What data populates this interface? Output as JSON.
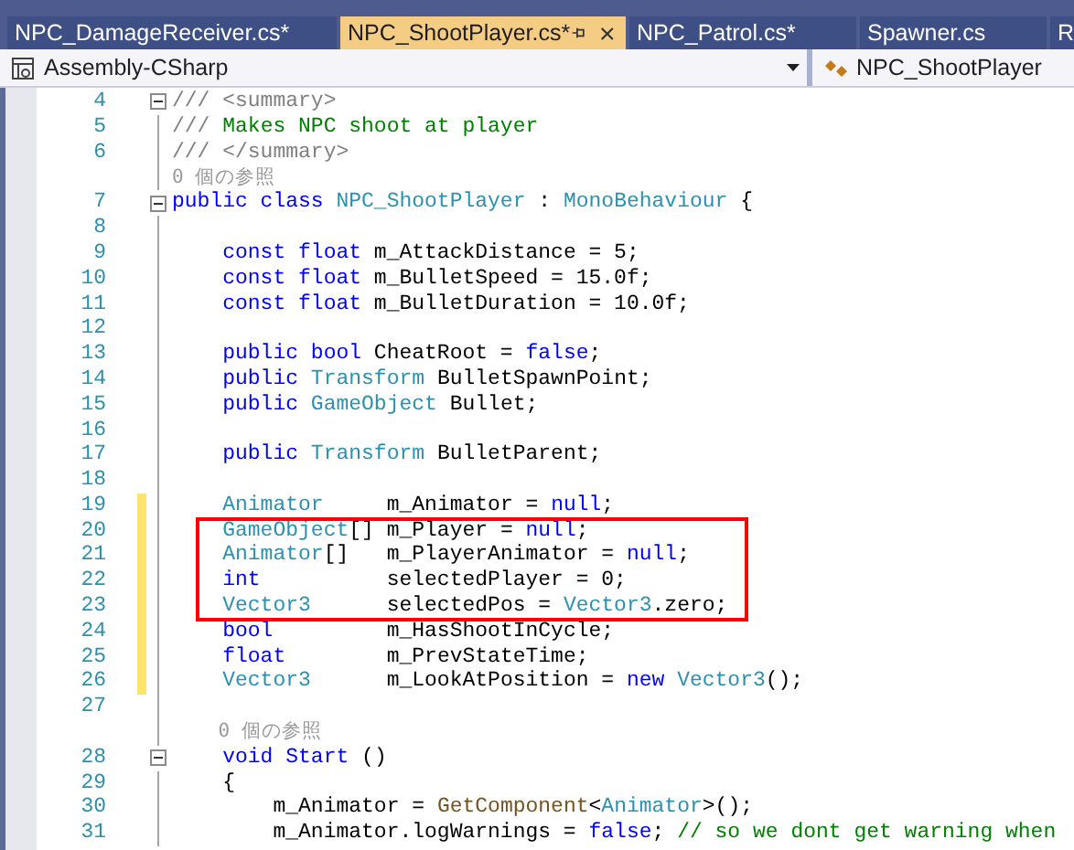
{
  "tabs": [
    {
      "label": "NPC_DamageReceiver.cs*",
      "selected": false
    },
    {
      "label": "NPC_ShootPlayer.cs*",
      "selected": true
    },
    {
      "label": "NPC_Patrol.cs*",
      "selected": false
    },
    {
      "label": "Spawner.cs",
      "selected": false
    },
    {
      "label": "R",
      "selected": false
    }
  ],
  "navigation_bar": {
    "project": "Assembly-CSharp",
    "class": "NPC_ShootPlayer"
  },
  "editor": {
    "lines": [
      {
        "kind": "code",
        "number": "4",
        "fold": true,
        "changed": false,
        "highlighted": false,
        "segments": [
          {
            "kind": "doc",
            "text": "/// <summary>"
          }
        ]
      },
      {
        "kind": "code",
        "number": "5",
        "fold": false,
        "changed": false,
        "highlighted": false,
        "segments": [
          {
            "kind": "doc",
            "text": "/// "
          },
          {
            "kind": "comment",
            "text": "Makes NPC shoot at player"
          }
        ]
      },
      {
        "kind": "code",
        "number": "6",
        "fold": false,
        "changed": false,
        "highlighted": false,
        "segments": [
          {
            "kind": "doc",
            "text": "/// </summary>"
          }
        ]
      },
      {
        "kind": "codelens",
        "text": "0 個の参照"
      },
      {
        "kind": "code",
        "number": "7",
        "fold": true,
        "changed": false,
        "highlighted": false,
        "segments": [
          {
            "kind": "keyword",
            "text": "public class "
          },
          {
            "kind": "type",
            "text": "NPC_ShootPlayer"
          },
          {
            "kind": "plain",
            "text": " : "
          },
          {
            "kind": "type",
            "text": "MonoBehaviour"
          },
          {
            "kind": "plain",
            "text": " {"
          }
        ]
      },
      {
        "kind": "code",
        "number": "8",
        "fold": false,
        "changed": false,
        "highlighted": false
      },
      {
        "kind": "code",
        "number": "9",
        "fold": false,
        "changed": false,
        "highlighted": false,
        "segments": [
          {
            "kind": "keyword",
            "text": "    const float "
          },
          {
            "kind": "plain",
            "text": "m_AttackDistance = 5;"
          }
        ]
      },
      {
        "kind": "code",
        "number": "10",
        "fold": false,
        "changed": false,
        "highlighted": false,
        "segments": [
          {
            "kind": "keyword",
            "text": "    const float "
          },
          {
            "kind": "plain",
            "text": "m_BulletSpeed = 15.0f;"
          }
        ]
      },
      {
        "kind": "code",
        "number": "11",
        "fold": false,
        "changed": false,
        "highlighted": false,
        "segments": [
          {
            "kind": "keyword",
            "text": "    const float "
          },
          {
            "kind": "plain",
            "text": "m_BulletDuration = 10.0f;"
          }
        ]
      },
      {
        "kind": "code",
        "number": "12",
        "fold": false,
        "changed": false,
        "highlighted": false
      },
      {
        "kind": "code",
        "number": "13",
        "fold": false,
        "changed": false,
        "highlighted": false,
        "segments": [
          {
            "kind": "keyword",
            "text": "    public bool "
          },
          {
            "kind": "plain",
            "text": "CheatRoot = "
          },
          {
            "kind": "keyword",
            "text": "false"
          },
          {
            "kind": "plain",
            "text": ";"
          }
        ]
      },
      {
        "kind": "code",
        "number": "14",
        "fold": false,
        "changed": false,
        "highlighted": false,
        "segments": [
          {
            "kind": "keyword",
            "text": "    public "
          },
          {
            "kind": "type",
            "text": "Transform"
          },
          {
            "kind": "plain",
            "text": " BulletSpawnPoint;"
          }
        ]
      },
      {
        "kind": "code",
        "number": "15",
        "fold": false,
        "changed": false,
        "highlighted": false,
        "segments": [
          {
            "kind": "keyword",
            "text": "    public "
          },
          {
            "kind": "type",
            "text": "GameObject"
          },
          {
            "kind": "plain",
            "text": " Bullet;"
          }
        ]
      },
      {
        "kind": "code",
        "number": "16",
        "fold": false,
        "changed": false,
        "highlighted": false
      },
      {
        "kind": "code",
        "number": "17",
        "fold": false,
        "changed": false,
        "highlighted": false,
        "segments": [
          {
            "kind": "keyword",
            "text": "    public "
          },
          {
            "kind": "type",
            "text": "Transform"
          },
          {
            "kind": "plain",
            "text": " BulletParent;"
          }
        ]
      },
      {
        "kind": "code",
        "number": "18",
        "fold": false,
        "changed": false,
        "highlighted": false
      },
      {
        "kind": "code",
        "number": "19",
        "fold": false,
        "changed": true,
        "highlighted": false,
        "segments": [
          {
            "kind": "type",
            "text": "    Animator"
          },
          {
            "kind": "plain",
            "text": "     m_Animator = "
          },
          {
            "kind": "keyword",
            "text": "null"
          },
          {
            "kind": "plain",
            "text": ";"
          }
        ]
      },
      {
        "kind": "code",
        "number": "20",
        "fold": false,
        "changed": true,
        "highlighted": true,
        "segments": [
          {
            "kind": "type",
            "text": "    GameObject"
          },
          {
            "kind": "plain",
            "text": "[] m_Player = "
          },
          {
            "kind": "keyword",
            "text": "null"
          },
          {
            "kind": "plain",
            "text": ";"
          }
        ]
      },
      {
        "kind": "code",
        "number": "21",
        "fold": false,
        "changed": true,
        "highlighted": true,
        "segments": [
          {
            "kind": "type",
            "text": "    Animator"
          },
          {
            "kind": "plain",
            "text": "[]   m_PlayerAnimator = "
          },
          {
            "kind": "keyword",
            "text": "null"
          },
          {
            "kind": "plain",
            "text": ";"
          }
        ]
      },
      {
        "kind": "code",
        "number": "22",
        "fold": false,
        "changed": true,
        "highlighted": true,
        "segments": [
          {
            "kind": "keyword",
            "text": "    int"
          },
          {
            "kind": "plain",
            "text": "          selectedPlayer = 0;"
          }
        ]
      },
      {
        "kind": "code",
        "number": "23",
        "fold": false,
        "changed": true,
        "highlighted": true,
        "segments": [
          {
            "kind": "type",
            "text": "    Vector3"
          },
          {
            "kind": "plain",
            "text": "      selectedPos = "
          },
          {
            "kind": "type",
            "text": "Vector3"
          },
          {
            "kind": "plain",
            "text": ".zero;"
          }
        ]
      },
      {
        "kind": "code",
        "number": "24",
        "fold": false,
        "changed": true,
        "highlighted": false,
        "segments": [
          {
            "kind": "keyword",
            "text": "    bool"
          },
          {
            "kind": "plain",
            "text": "         m_HasShootInCycle;"
          }
        ]
      },
      {
        "kind": "code",
        "number": "25",
        "fold": false,
        "changed": true,
        "highlighted": false,
        "segments": [
          {
            "kind": "keyword",
            "text": "    float"
          },
          {
            "kind": "plain",
            "text": "        m_PrevStateTime;"
          }
        ]
      },
      {
        "kind": "code",
        "number": "26",
        "fold": false,
        "changed": true,
        "highlighted": false,
        "segments": [
          {
            "kind": "type",
            "text": "    Vector3"
          },
          {
            "kind": "plain",
            "text": "      m_LookAtPosition = "
          },
          {
            "kind": "keyword",
            "text": "new "
          },
          {
            "kind": "type",
            "text": "Vector3"
          },
          {
            "kind": "plain",
            "text": "();"
          }
        ]
      },
      {
        "kind": "code",
        "number": "27",
        "fold": false,
        "changed": false,
        "highlighted": false
      },
      {
        "kind": "codelens",
        "text": "    0 個の参照"
      },
      {
        "kind": "code",
        "number": "28",
        "fold": true,
        "changed": false,
        "highlighted": false,
        "segments": [
          {
            "kind": "keyword",
            "text": "    void "
          },
          {
            "kind": "name",
            "text": "Start"
          },
          {
            "kind": "plain",
            "text": " ()"
          }
        ]
      },
      {
        "kind": "code",
        "number": "29",
        "fold": false,
        "changed": false,
        "highlighted": false,
        "segments": [
          {
            "kind": "plain",
            "text": "    {"
          }
        ]
      },
      {
        "kind": "code",
        "number": "30",
        "fold": false,
        "changed": false,
        "highlighted": false,
        "segments": [
          {
            "kind": "plain",
            "text": "        m_Animator = "
          },
          {
            "kind": "method",
            "text": "GetComponent"
          },
          {
            "kind": "plain",
            "text": "<"
          },
          {
            "kind": "type",
            "text": "Animator"
          },
          {
            "kind": "plain",
            "text": ">();"
          }
        ]
      },
      {
        "kind": "code",
        "number": "31",
        "fold": false,
        "changed": false,
        "highlighted": false,
        "segments": [
          {
            "kind": "plain",
            "text": "        m_Animator.logWarnings = "
          },
          {
            "kind": "keyword",
            "text": "false"
          },
          {
            "kind": "plain",
            "text": "; "
          },
          {
            "kind": "comment",
            "text": "// so we dont get warning when"
          }
        ]
      }
    ]
  }
}
